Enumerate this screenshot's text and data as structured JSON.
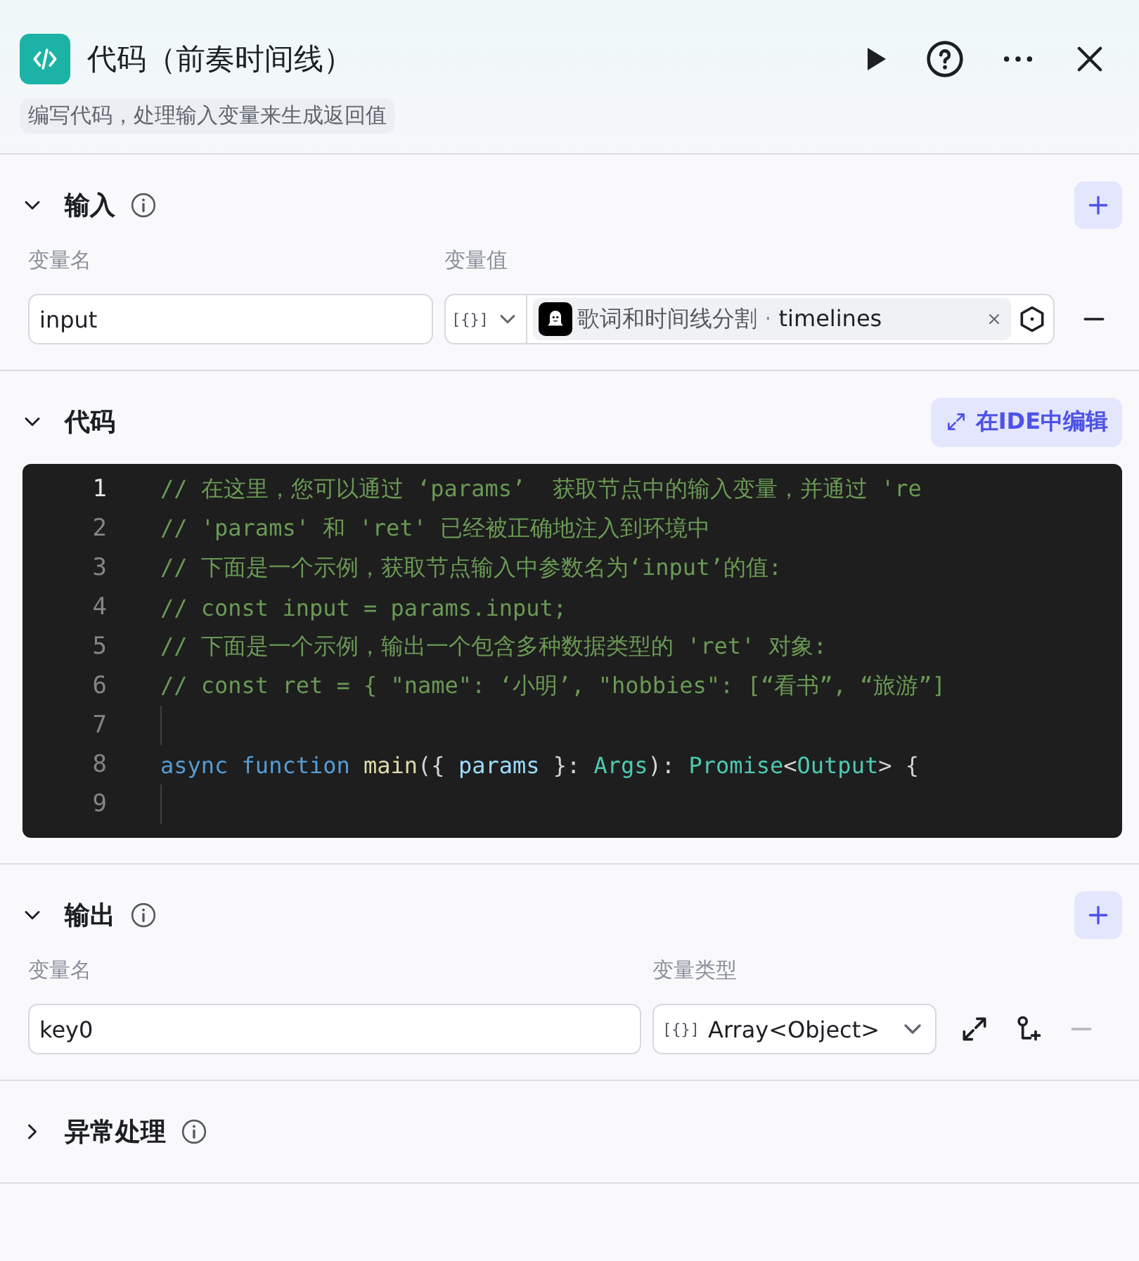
{
  "header": {
    "title": "代码（前奏时间线）",
    "description": "编写代码，处理输入变量来生成返回值"
  },
  "sections": [
    {
      "kind": "input",
      "title": "输入",
      "expanded": true,
      "info": true,
      "columns": [
        "变量名",
        "变量值"
      ],
      "rows": [
        {
          "name": "input",
          "type_icon": "[{}]",
          "source": "歌词和时间线分割",
          "separator": "·",
          "source_field": "timelines",
          "removable": true
        }
      ]
    },
    {
      "kind": "code",
      "title": "代码",
      "expanded": true,
      "info": false,
      "action": "在IDE中编辑",
      "lines": [
        {
          "number": "1",
          "active": true,
          "tokens": [
            {
              "kind": "comment",
              "text": "// 在这里，您可以通过 ‘params’  获取节点中的输入变量，并通过 're"
            }
          ]
        },
        {
          "number": "2",
          "active": false,
          "tokens": [
            {
              "kind": "comment",
              "text": "// 'params' 和 'ret' 已经被正确地注入到环境中"
            }
          ]
        },
        {
          "number": "3",
          "active": false,
          "tokens": [
            {
              "kind": "comment",
              "text": "// 下面是一个示例，获取节点输入中参数名为‘input’的值:"
            }
          ]
        },
        {
          "number": "4",
          "active": false,
          "tokens": [
            {
              "kind": "comment",
              "text": "// const input = params.input;"
            }
          ]
        },
        {
          "number": "5",
          "active": false,
          "tokens": [
            {
              "kind": "comment",
              "text": "// 下面是一个示例，输出一个包含多种数据类型的 'ret' 对象:"
            }
          ]
        },
        {
          "number": "6",
          "active": false,
          "tokens": [
            {
              "kind": "comment",
              "text": "// const ret = { \"name\": ‘小明’, \"hobbies\": [“看书”, “旅游”]"
            }
          ]
        },
        {
          "number": "7",
          "active": false
        },
        {
          "number": "8",
          "active": false,
          "tokens": [
            {
              "kind": "keyword",
              "text": "async function "
            },
            {
              "kind": "func",
              "text": "main"
            },
            {
              "kind": "plain",
              "text": "({ "
            },
            {
              "kind": "param",
              "text": "params"
            },
            {
              "kind": "plain",
              "text": " }: "
            },
            {
              "kind": "type",
              "text": "Args"
            },
            {
              "kind": "plain",
              "text": "): "
            },
            {
              "kind": "type",
              "text": "Promise"
            },
            {
              "kind": "plain",
              "text": "<"
            },
            {
              "kind": "type",
              "text": "Output"
            },
            {
              "kind": "plain",
              "text": "> {"
            }
          ]
        },
        {
          "number": "9",
          "active": false
        }
      ]
    },
    {
      "kind": "output",
      "title": "输出",
      "expanded": true,
      "info": true,
      "columns": [
        "变量名",
        "变量类型"
      ],
      "rows": [
        {
          "name": "key0",
          "type_icon": "[{}]",
          "type": "Array<Object>",
          "removable": false
        }
      ]
    },
    {
      "kind": "error",
      "title": "异常处理",
      "expanded": false,
      "info": true
    }
  ]
}
